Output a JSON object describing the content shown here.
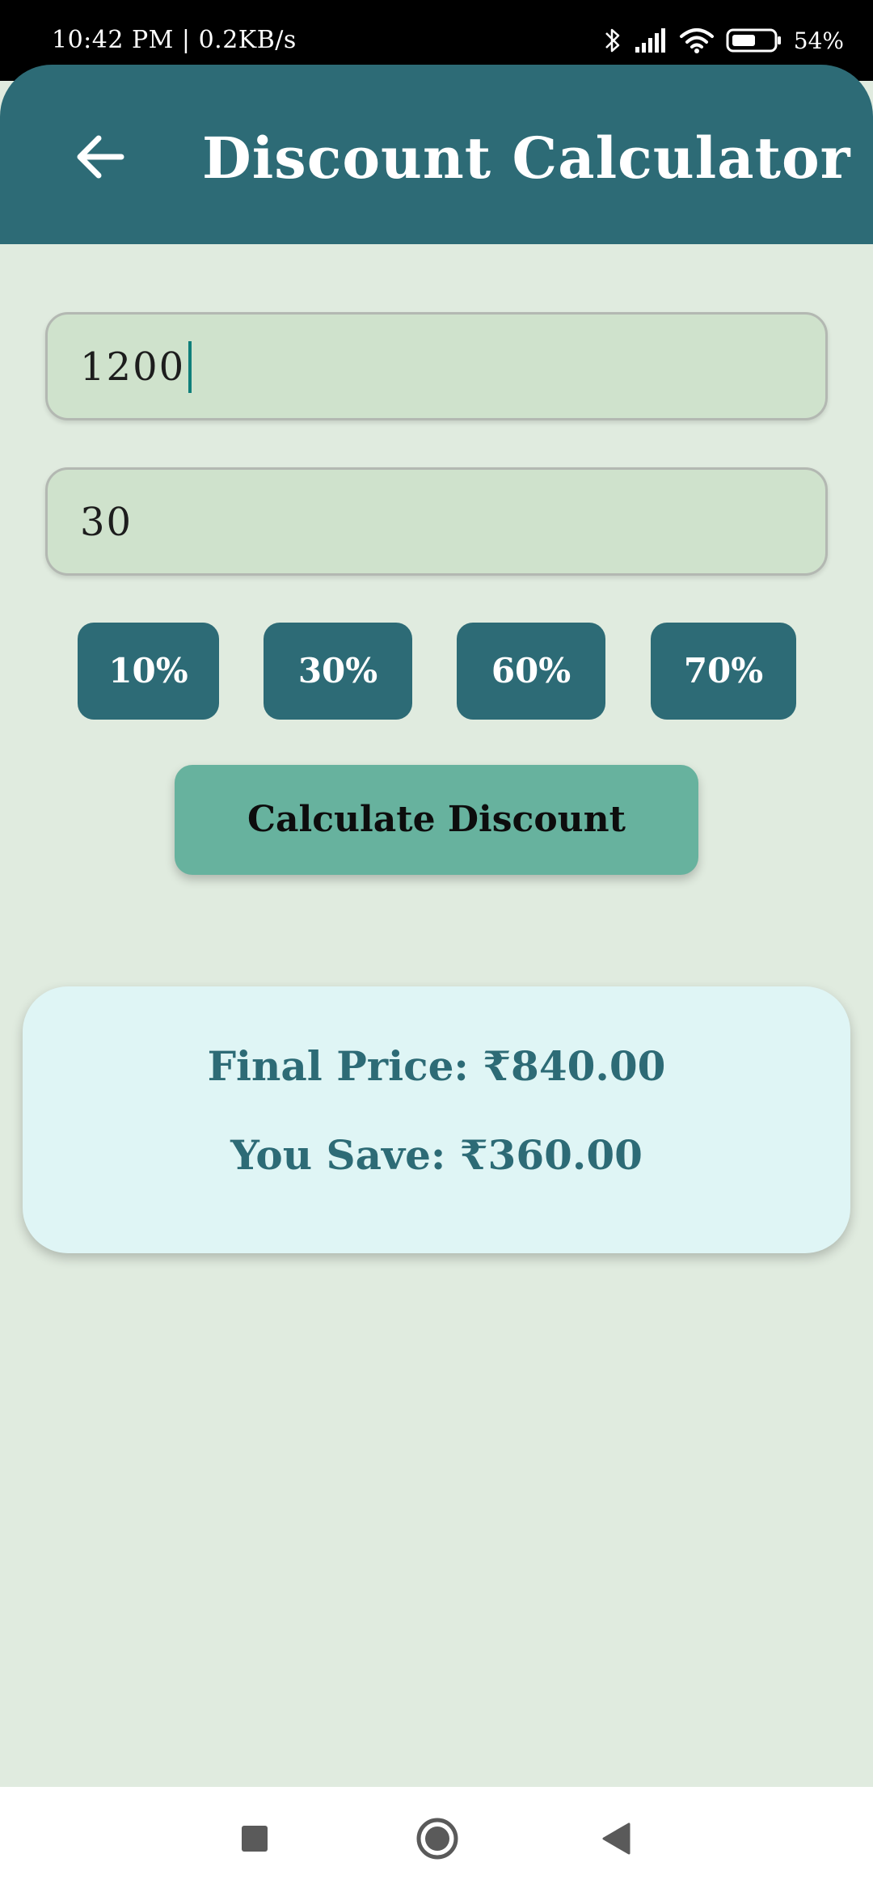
{
  "status_bar": {
    "time_speed": "10:42 PM | 0.2KB/s",
    "battery_percent": "54%"
  },
  "app_bar": {
    "title": "Discount Calculator",
    "back_icon": "arrow-left-icon"
  },
  "form": {
    "price_value": "1200",
    "discount_value": "30"
  },
  "presets": [
    "10%",
    "30%",
    "60%",
    "70%"
  ],
  "calculate_label": "Calculate Discount",
  "result": {
    "final_price": "Final Price: ₹840.00",
    "you_save": "You Save: ₹360.00"
  },
  "colors": {
    "primary": "#2d6b76",
    "accent": "#67b29e",
    "background": "#e0ebdf",
    "input_fill": "#cfe2cc",
    "result_card": "#dff5f5"
  },
  "nav_icons": [
    "square-recents-icon",
    "circle-home-icon",
    "triangle-back-icon"
  ]
}
